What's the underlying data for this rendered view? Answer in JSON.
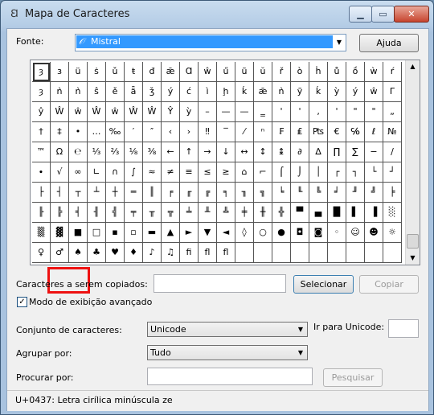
{
  "window": {
    "title": "Mapa de Caracteres",
    "min_label": "▁",
    "max_label": "▭",
    "close_label": "✕"
  },
  "font": {
    "label": "Fonte:",
    "value": "Mistral",
    "help_button": "Ajuda"
  },
  "grid": {
    "rows": [
      [
        "ȝ",
        "з",
        "ü",
        "ṡ",
        "ǔ",
        "ŧ",
        "đ",
        "ǣ",
        "Ɑ",
        "ŵ",
        "ű",
        "ũ",
        "ŭ",
        "ř",
        "ò",
        "ḣ",
        "ů",
        "ṍ",
        "ẁ",
        "ŕ"
      ],
      [
        "ȝ",
        "ǹ",
        "ǹ",
        "ŝ",
        "ě",
        "ǟ",
        "ǯ",
        "ý",
        "ć",
        "ì",
        "ḩ",
        "ḱ",
        "ǣ",
        "ǹ",
        "ỹ",
        "ḱ",
        "ỳ",
        "ý",
        "ŵ",
        "Γ"
      ],
      [
        "ŷ",
        "Ŵ",
        "ŵ",
        "Ŵ",
        "ŵ",
        "Ŵ",
        "Ŵ",
        "Ŷ",
        "ỳ",
        "–",
        "—",
        "—",
        "‗",
        "'",
        "'",
        "‚",
        "'",
        "\"",
        "\"",
        "„"
      ],
      [
        "†",
        "‡",
        "•",
        "…",
        "‰",
        "′",
        "″",
        "‹",
        "›",
        "‼",
        "‾",
        "⁄",
        "ⁿ",
        "₣",
        "₤",
        "₧",
        "€",
        "℅",
        "ℓ",
        "№"
      ],
      [
        "™",
        "Ω",
        "℮",
        "⅓",
        "⅔",
        "⅛",
        "⅜",
        "←",
        "↑",
        "→",
        "↓",
        "↔",
        "↕",
        "↨",
        "∂",
        "∆",
        "∏",
        "∑",
        "−",
        "∕"
      ],
      [
        "∙",
        "√",
        "∞",
        "∟",
        "∩",
        "∫",
        "≈",
        "≠",
        "≡",
        "≤",
        "≥",
        "⌂",
        "⌐",
        "⌠",
        "⌡",
        "│",
        "┌",
        "┐",
        "└",
        "┘"
      ],
      [
        "├",
        "┤",
        "┬",
        "┴",
        "┼",
        "═",
        "║",
        "╒",
        "╓",
        "╔",
        "╕",
        "╖",
        "╗",
        "╘",
        "╙",
        "╚",
        "╛",
        "╜",
        "╝",
        "╞"
      ],
      [
        "╟",
        "╠",
        "╡",
        "╢",
        "╣",
        "╤",
        "╥",
        "╦",
        "╧",
        "╨",
        "╩",
        "╪",
        "╫",
        "╬",
        "▀",
        "▄",
        "█",
        "▌",
        "▐",
        "░"
      ],
      [
        "▒",
        "▓",
        "■",
        "□",
        "▪",
        "▫",
        "▬",
        "▲",
        "►",
        "▼",
        "◄",
        "◊",
        "○",
        "●",
        "◘",
        "◙",
        "◦",
        "☺",
        "☻",
        "☼"
      ],
      [
        "♀",
        "♂",
        "♠",
        "♣",
        "♥",
        "♦",
        "♪",
        "♫",
        "ﬁ",
        "ﬂ",
        "ﬂ",
        "",
        "",
        "",
        "",
        "",
        "",
        "",
        "",
        ""
      ]
    ]
  },
  "copy": {
    "label": "Caracteres a serem copiados:",
    "value": "",
    "select_button": "Selecionar",
    "copy_button": "Copiar"
  },
  "advanced": {
    "label": "Modo de exibição avançado",
    "checked": "✓"
  },
  "charset": {
    "label": "Conjunto de caracteres:",
    "value": "Unicode",
    "goto_label": "Ir para Unicode:",
    "goto_value": ""
  },
  "group": {
    "label": "Agrupar por:",
    "value": "Tudo"
  },
  "search": {
    "label": "Procurar por:",
    "value": "",
    "button": "Pesquisar"
  },
  "status": {
    "text": "U+0437: Letra cirílica minúscula ze"
  }
}
